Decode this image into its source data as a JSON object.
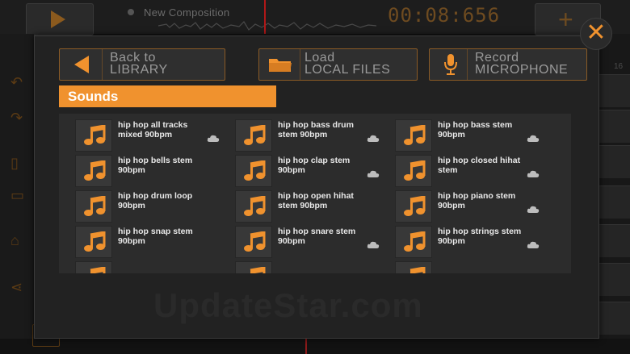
{
  "background": {
    "composition_title": "New Composition",
    "timer": "00:08:656",
    "right_track_number": "16",
    "watermark": "UpdateStar.com"
  },
  "modal": {
    "close_symbol": "✕",
    "back_button": {
      "line1": "Back to",
      "line2": "LIBRARY",
      "icon": "left-arrow-icon"
    },
    "load_button": {
      "line1": "Load",
      "line2": "LOCAL FILES",
      "icon": "folder-icon"
    },
    "record_button": {
      "line1": "Record",
      "line2": "MICROPHONE",
      "icon": "microphone-icon"
    },
    "active_tab": "Sounds",
    "sounds": [
      {
        "line1": "hip hop all tracks",
        "line2": "mixed 90bpm"
      },
      {
        "line1": "hip hop bass drum",
        "line2": "stem  90bpm"
      },
      {
        "line1": "hip hop bass stem",
        "line2": "90bpm"
      },
      {
        "line1": "hip hop bells stem",
        "line2": "90bpm"
      },
      {
        "line1": "hip hop clap stem",
        "line2": "90bpm"
      },
      {
        "line1": "hip hop closed hihat",
        "line2": "stem"
      },
      {
        "line1": "hip hop drum loop",
        "line2": "90bpm"
      },
      {
        "line1": "hip hop open hihat",
        "line2": "stem 90bpm"
      },
      {
        "line1": "hip hop piano stem",
        "line2": "90bpm"
      },
      {
        "line1": "hip hop snap stem",
        "line2": "90bpm"
      },
      {
        "line1": "hip hop snare stem",
        "line2": "90bpm"
      },
      {
        "line1": "hip hop strings stem",
        "line2": "90bpm"
      }
    ]
  },
  "colors": {
    "accent": "#f0922e",
    "panel": "#2c2c2c",
    "tile": "#383838"
  }
}
